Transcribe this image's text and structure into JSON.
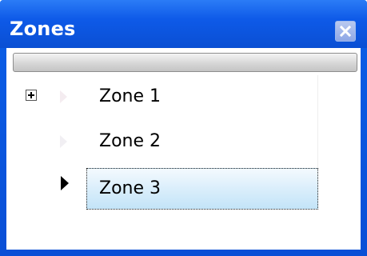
{
  "window": {
    "title": "Zones"
  },
  "tree": {
    "rows": [
      {
        "label": "Zone 1",
        "expandable": true,
        "selected": false
      },
      {
        "label": "Zone 2",
        "expandable": false,
        "selected": false
      },
      {
        "label": "Zone 3",
        "expandable": false,
        "selected": true
      }
    ]
  },
  "colors": {
    "titlebar": "#0a4fd3",
    "selection": "#c3e4f8"
  },
  "icons": {
    "close": "close-icon",
    "expand": "plus-expander-icon",
    "current_row": "row-indicator-arrow-icon"
  }
}
